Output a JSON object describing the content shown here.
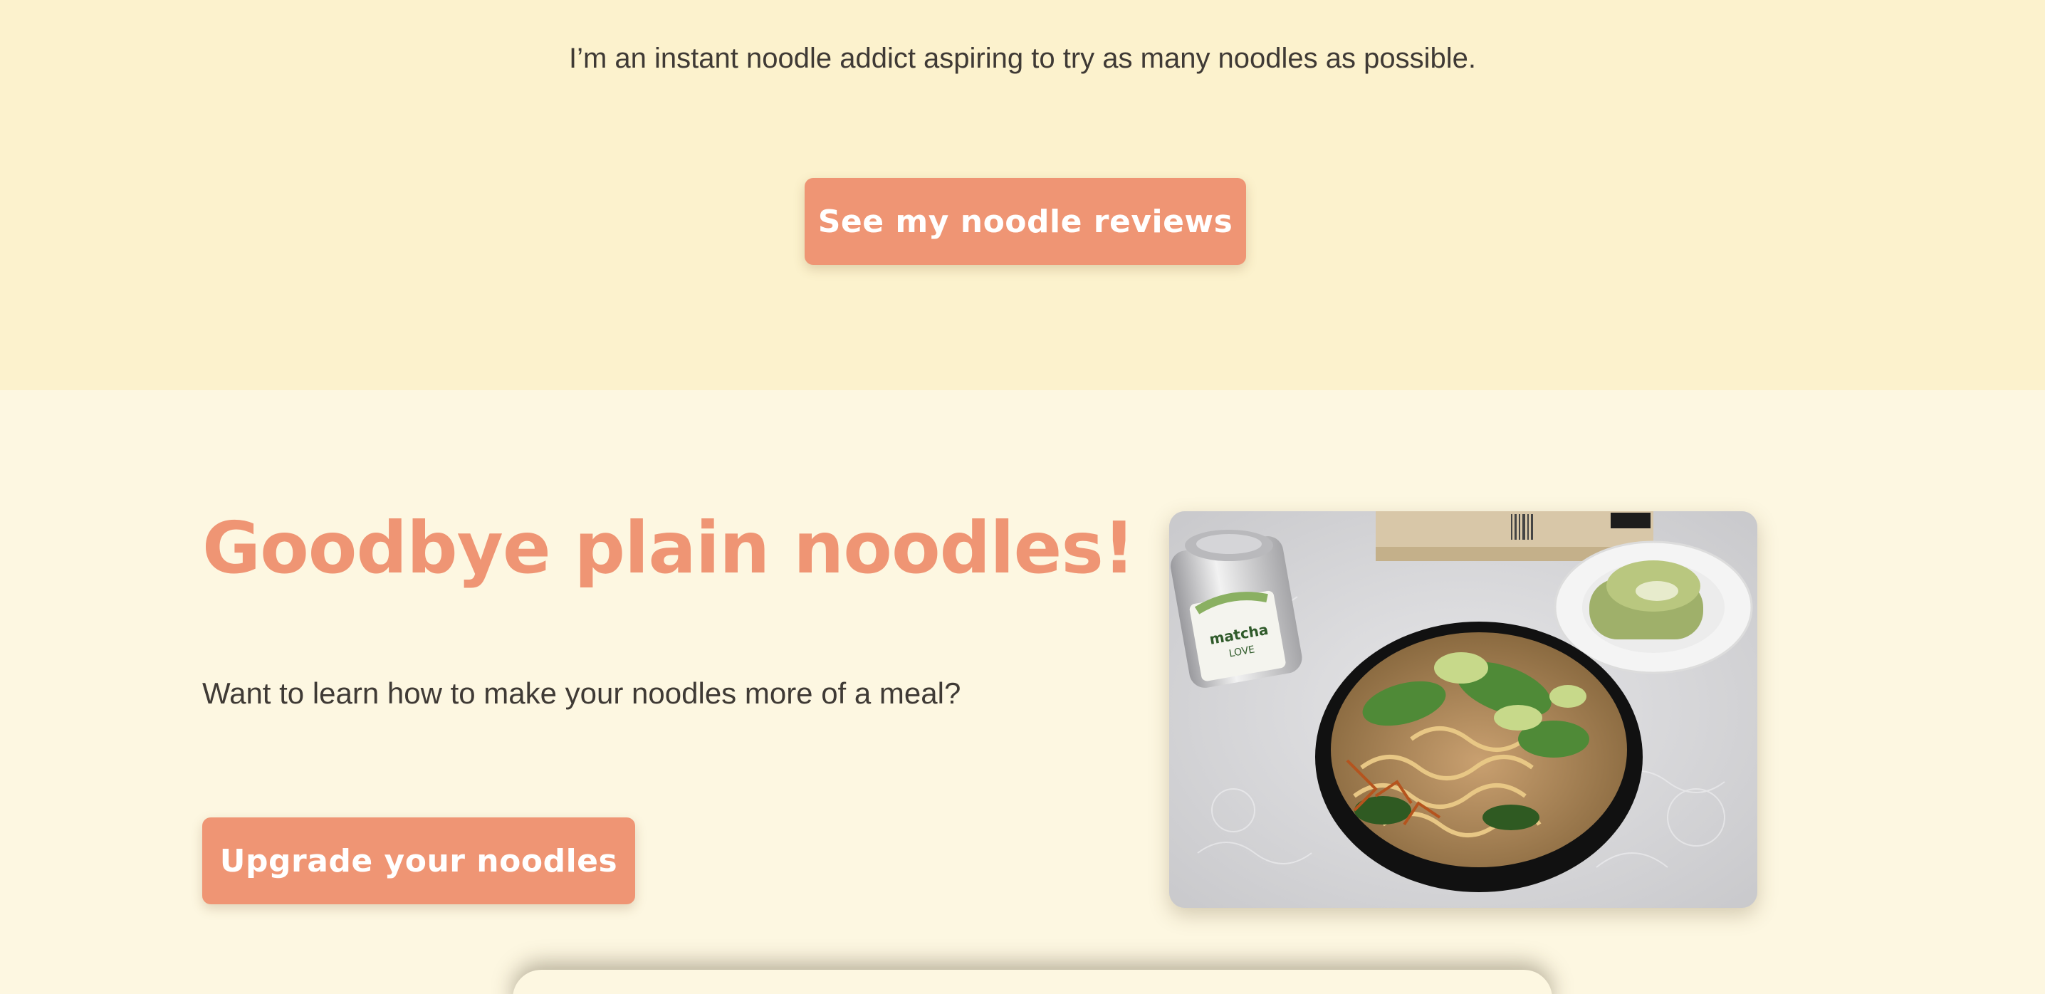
{
  "hero": {
    "tagline": "I’m an instant noodle addict aspiring to try as many noodles as possible.",
    "button_label": "See my noodle reviews"
  },
  "feature": {
    "title": "Goodbye plain noodles!",
    "description": "Want to learn how to make your noodles more of a meal?",
    "button_label": "Upgrade your noodles",
    "photo": {
      "can_brand": "matcha",
      "can_brand_2": "LOVE"
    }
  },
  "colors": {
    "hero_bg": "#fcf2cd",
    "section_bg": "#fdf7e1",
    "accent": "#ef9574",
    "text": "#3f3a35"
  }
}
